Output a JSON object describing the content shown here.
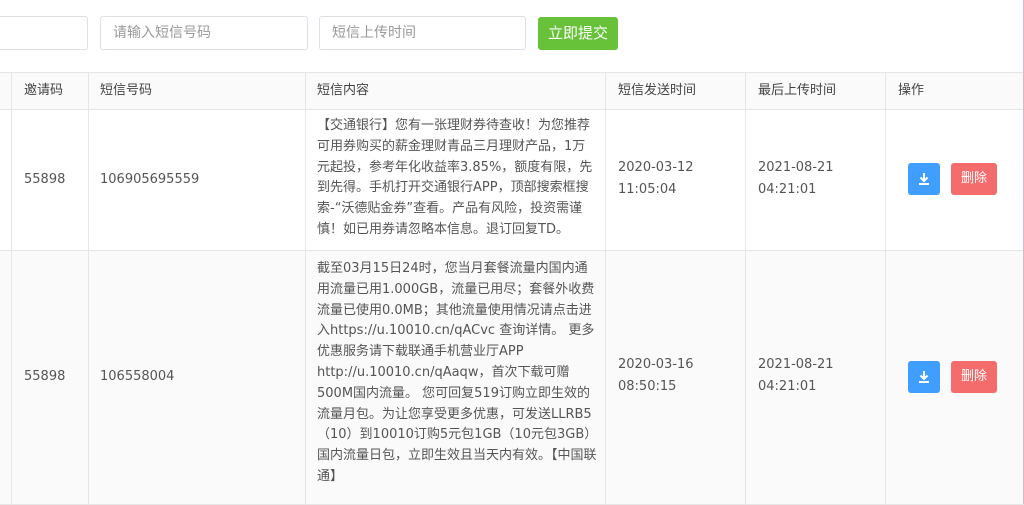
{
  "filters": {
    "input1_placeholder": "",
    "sms_number_placeholder": "请输入短信号码",
    "upload_time_placeholder": "短信上传时间",
    "submit_label": "立即提交"
  },
  "table": {
    "headers": [
      "邀请码",
      "短信号码",
      "短信内容",
      "短信发送时间",
      "最后上传时间",
      "操作"
    ],
    "rows": [
      {
        "invite_code": "55898",
        "sms_number": "106905695559",
        "content": "【交通银行】您有一张理财券待查收！为您推荐可用券购买的薪金理财青品三月理财产品，1万元起投，参考年化收益率3.85%，额度有限，先到先得。手机打开交通银行APP，顶部搜索框搜索-“沃德贴金券”查看。产品有风险，投资需谨慎！如已用券请忽略本信息。退订回复TD。",
        "send_date": "2020-03-12",
        "send_time": "11:05:04",
        "upload_date": "2021-08-21",
        "upload_time": "04:21:01",
        "delete_label": "删除"
      },
      {
        "invite_code": "55898",
        "sms_number": "106558004",
        "content": "截至03月15日24时，您当月套餐流量内国内通用流量已用1.000GB，流量已用尽；套餐外收费流量已使用0.0MB；其他流量使用情况请点击进入https://u.10010.cn/qACvc 查询详情。 更多优惠服务请下载联通手机营业厅APP http://u.10010.cn/qAaqw，首次下载可赠500M国内流量。 您可回复519订购立即生效的流量月包。为让您享受更多优惠，可发送LLRB5（10）到10010订购5元包1GB（10元包3GB）国内流量日包，立即生效且当天内有效。【中国联通】",
        "send_date": "2020-03-16",
        "send_time": "08:50:15",
        "upload_date": "2021-08-21",
        "upload_time": "04:21:01",
        "delete_label": "删除"
      }
    ]
  },
  "icons": {
    "download": "download-icon"
  },
  "colors": {
    "submit": "#67c23a",
    "download": "#409eff",
    "delete": "#f56c6c"
  }
}
